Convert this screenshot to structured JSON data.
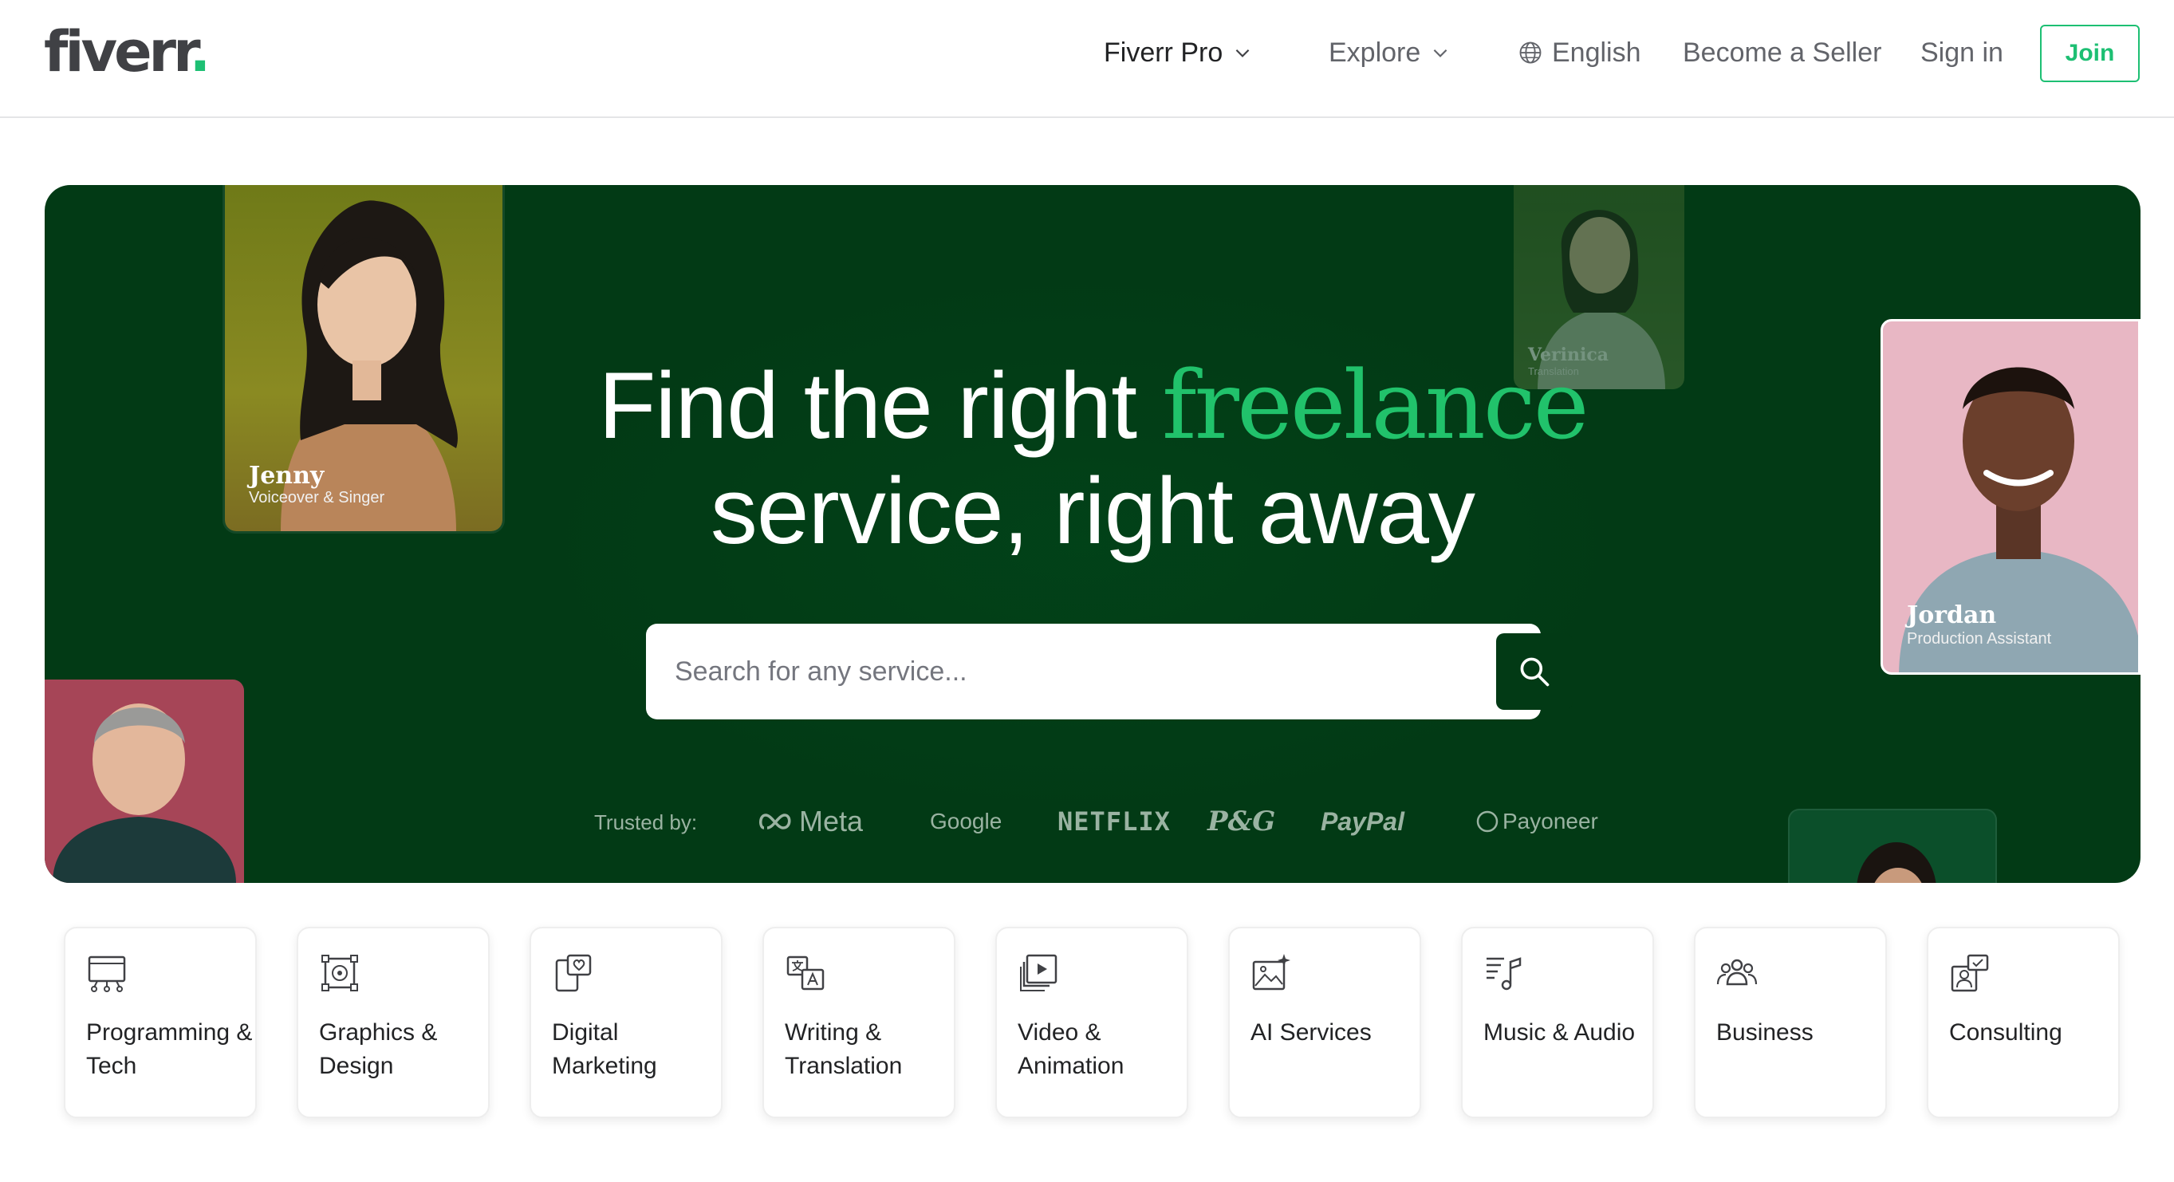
{
  "brand": {
    "logo_text": "fiverr",
    "logo_dot": ".",
    "accent_color": "#1dbf73",
    "hero_bg": "#023a15"
  },
  "nav": {
    "fiverr_pro": "Fiverr Pro",
    "explore": "Explore",
    "language": "English",
    "become_seller": "Become a Seller",
    "sign_in": "Sign in",
    "join": "Join"
  },
  "hero": {
    "title_part1": "Find the right ",
    "title_accent": "freelance",
    "title_part2": "service, right away",
    "search_placeholder": "Search for any service...",
    "trusted_label": "Trusted by:",
    "trusted_brands": [
      "Meta",
      "Google",
      "NETFLIX",
      "P&G",
      "PayPal",
      "Payoneer"
    ]
  },
  "freelancers": [
    {
      "name": "Jenny",
      "role": "Voiceover & Singer"
    },
    {
      "name": "Verinica",
      "role": "Translation"
    },
    {
      "name": "Jordan",
      "role": "Production Assistant"
    }
  ],
  "categories": [
    {
      "label": "Programming & Tech",
      "icon": "monitor-icon"
    },
    {
      "label": "Graphics & Design",
      "icon": "design-frame-icon"
    },
    {
      "label": "Digital Marketing",
      "icon": "phone-heart-icon"
    },
    {
      "label": "Writing & Translation",
      "icon": "translate-icon"
    },
    {
      "label": "Video & Animation",
      "icon": "video-play-icon"
    },
    {
      "label": "AI Services",
      "icon": "ai-image-icon"
    },
    {
      "label": "Music & Audio",
      "icon": "music-note-icon"
    },
    {
      "label": "Business",
      "icon": "people-group-icon"
    },
    {
      "label": "Consulting",
      "icon": "consulting-icon"
    }
  ]
}
